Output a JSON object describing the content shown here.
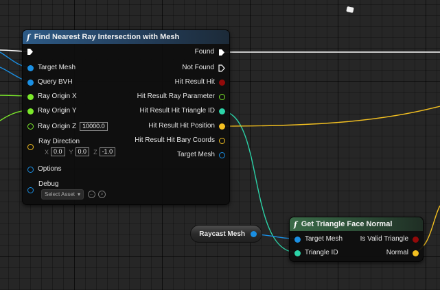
{
  "colors": {
    "exec": "#ffffff",
    "object": "#1a8fe3",
    "int": "#2cd3a8",
    "float": "#7be82a",
    "bool": "#930a0a",
    "vector": "#f3c021",
    "struct": "#1a8fe3"
  },
  "find_node": {
    "title": "Find Nearest Ray Intersection with Mesh",
    "icon": "function-icon",
    "inputs": {
      "exec": "",
      "target_mesh": "Target Mesh",
      "query_bvh": "Query BVH",
      "ray_origin_x": "Ray Origin X",
      "ray_origin_y": "Ray Origin Y",
      "ray_origin_z": "Ray Origin Z",
      "ray_origin_z_value": "10000.0",
      "ray_direction": "Ray Direction",
      "dir_x_label": "X",
      "dir_x": "0.0",
      "dir_y_label": "Y",
      "dir_y": "0.0",
      "dir_z_label": "Z",
      "dir_z": "-1.0",
      "options": "Options",
      "debug": "Debug",
      "select_asset": "Select Asset"
    },
    "outputs": {
      "found": "Found",
      "not_found": "Not Found",
      "hit_result_hit": "Hit Result Hit",
      "hit_result_ray_parameter": "Hit Result Ray Parameter",
      "hit_result_hit_triangle_id": "Hit Result Hit Triangle ID",
      "hit_result_hit_position": "Hit Result Hit Position",
      "hit_result_hit_bary_coords": "Hit Result Hit Bary Coords",
      "target_mesh": "Target Mesh"
    }
  },
  "face_node": {
    "title": "Get Triangle Face Normal",
    "icon": "function-icon",
    "inputs": {
      "target_mesh": "Target Mesh",
      "triangle_id": "Triangle ID"
    },
    "outputs": {
      "is_valid_triangle": "Is Valid Triangle",
      "normal": "Normal"
    }
  },
  "variable_node": {
    "label": "Raycast Mesh"
  }
}
